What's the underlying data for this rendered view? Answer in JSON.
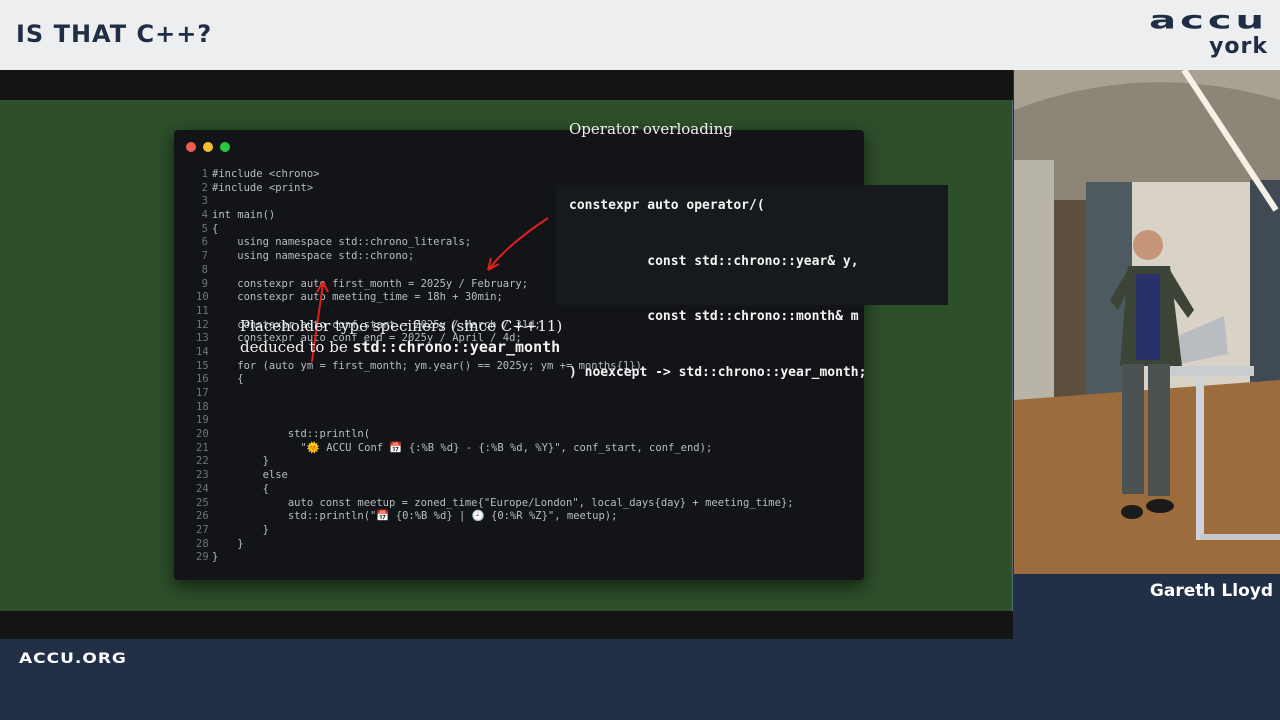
{
  "header": {
    "title": "IS THAT C++?",
    "logo_main": "accu",
    "logo_sub": "york"
  },
  "code_window": {
    "lines": [
      {
        "n": "1",
        "t": "#include <chrono>"
      },
      {
        "n": "2",
        "t": "#include <print>"
      },
      {
        "n": "3",
        "t": ""
      },
      {
        "n": "4",
        "t": "int main()"
      },
      {
        "n": "5",
        "t": "{"
      },
      {
        "n": "6",
        "t": "    using namespace std::chrono_literals;"
      },
      {
        "n": "7",
        "t": "    using namespace std::chrono;"
      },
      {
        "n": "8",
        "t": ""
      },
      {
        "n": "9",
        "t": "    constexpr auto first_month = 2025y / February;"
      },
      {
        "n": "10",
        "t": "    constexpr auto meeting_time = 18h + 30min;"
      },
      {
        "n": "11",
        "t": ""
      },
      {
        "n": "12",
        "t": "    constexpr auto conf_start = 2025y / March / 31d;"
      },
      {
        "n": "13",
        "t": "    constexpr auto conf_end = 2025y / April / 4d;"
      },
      {
        "n": "14",
        "t": ""
      },
      {
        "n": "15",
        "t": "    for (auto ym = first_month; ym.year() == 2025y; ym += months{1})"
      },
      {
        "n": "16",
        "t": "    {"
      },
      {
        "n": "17",
        "t": ""
      },
      {
        "n": "18",
        "t": ""
      },
      {
        "n": "19",
        "t": ""
      },
      {
        "n": "20",
        "t": "            std::println("
      },
      {
        "n": "21",
        "t": "              \"🌞 ACCU Conf 📅 {:%B %d} - {:%B %d, %Y}\", conf_start, conf_end);"
      },
      {
        "n": "22",
        "t": "        }"
      },
      {
        "n": "23",
        "t": "        else"
      },
      {
        "n": "24",
        "t": "        {"
      },
      {
        "n": "25",
        "t": "            auto const meetup = zoned_time{\"Europe/London\", local_days{day} + meeting_time};"
      },
      {
        "n": "26",
        "t": "            std::println(\"📅 {0:%B %d} | 🕘 {0:%R %Z}\", meetup);"
      },
      {
        "n": "27",
        "t": "        }"
      },
      {
        "n": "28",
        "t": "    }"
      },
      {
        "n": "29",
        "t": "}"
      }
    ]
  },
  "callout": {
    "heading": "Operator overloading",
    "code_lines": [
      "constexpr auto operator/(",
      "          const std::chrono::year& y,",
      "          const std::chrono::month& m",
      ") noexcept -> std::chrono::year_month;"
    ]
  },
  "annotation": {
    "line1": "Placeholder type specifiers (since C++11)",
    "line2_prefix": "deduced to be ",
    "line2_code": "std::chrono::year_month"
  },
  "speaker": {
    "name": "Gareth Lloyd"
  },
  "footer": {
    "site": "ACCU.ORG"
  },
  "colors": {
    "header_bg": "#eceef0",
    "brand_navy": "#1f2d45",
    "slide_green": "#2d4f2a",
    "code_bg": "#121417",
    "annotation_arrow": "#e0201d"
  }
}
